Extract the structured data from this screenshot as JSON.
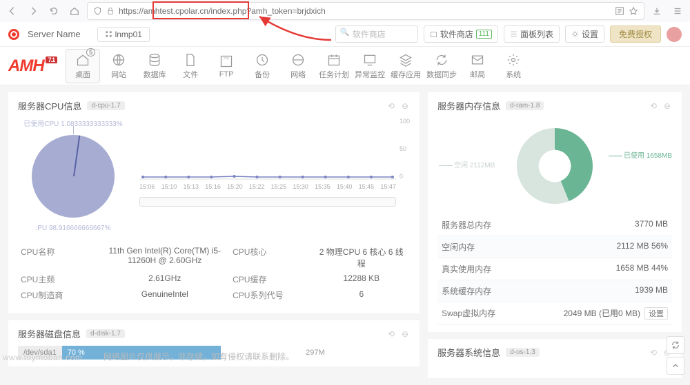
{
  "browser": {
    "url_full": "https://amhtest.cpolar.cn/index.php?amh_token=brjdxich",
    "url_highlighted": "https://amhtest.cpolar.cn"
  },
  "header": {
    "server_name": "Server Name",
    "env_tag": "lnmp01",
    "search_placeholder": "软件商店",
    "store_label": "软件商店",
    "store_badge": "111",
    "panel_list": "面板列表",
    "settings": "设置",
    "auth": "免费授权"
  },
  "logo": {
    "text": "AMH",
    "ver": "7.1"
  },
  "nav": [
    {
      "label": "桌面",
      "badge": "5",
      "active": true
    },
    {
      "label": "网站"
    },
    {
      "label": "数据库"
    },
    {
      "label": "文件"
    },
    {
      "label": "FTP"
    },
    {
      "label": "备份"
    },
    {
      "label": "网络"
    },
    {
      "label": "任务计划"
    },
    {
      "label": "异常监控"
    },
    {
      "label": "缓存应用"
    },
    {
      "label": "数据同步"
    },
    {
      "label": "邮局"
    },
    {
      "label": "系统"
    }
  ],
  "cpu_panel": {
    "title": "服务器CPU信息",
    "module": "d-cpu-1.7",
    "pie_used_label": "已使用CPU 1.0833333333333%",
    "pie_free_label": ":PU 98.916666666667%"
  },
  "chart_data": {
    "type": "line",
    "title": "",
    "xlabel": "",
    "ylabel": "",
    "ylim": [
      0,
      100
    ],
    "x": [
      "15:06",
      "15:10",
      "15:13",
      "15:16",
      "15:20",
      "15:22",
      "15:25",
      "15:30",
      "15:35",
      "15:40",
      "15:45",
      "15:47"
    ],
    "series": [
      {
        "name": "CPU",
        "values": [
          2,
          2,
          2,
          2,
          3,
          2,
          2,
          2,
          2,
          2,
          2,
          2
        ]
      }
    ],
    "yticks": [
      0,
      50,
      100
    ]
  },
  "cpu_info": {
    "name_label": "CPU名称",
    "name_val": "11th Gen Intel(R) Core(TM) i5-11260H @ 2.60GHz",
    "core_label": "CPU核心",
    "core_val": "2 物理CPU  6 核心  6 线程",
    "freq_label": "CPU主频",
    "freq_val": "2.61GHz",
    "cache_label": "CPU缓存",
    "cache_val": "12288 KB",
    "vendor_label": "CPU制造商",
    "vendor_val": "GenuineIntel",
    "family_label": "CPU系列代号",
    "family_val": "6"
  },
  "disk_panel": {
    "title": "服务器磁盘信息",
    "module": "d-disk-1.7",
    "dev": "/dev/sda1",
    "used_pct": "70 %",
    "total": "297M"
  },
  "ram_panel": {
    "title": "服务器内存信息",
    "module": "d-ram-1.8",
    "used_label": "已使用 1658MB",
    "free_label": "空闲 2112MB"
  },
  "mem_table": [
    {
      "k": "服务器总内存",
      "v": "3770 MB"
    },
    {
      "k": "空闲内存",
      "v": "2112 MB   56%"
    },
    {
      "k": "真实使用内存",
      "v": "1658 MB   44%"
    },
    {
      "k": "系统缓存内存",
      "v": "1939 MB"
    },
    {
      "k": "Swap虚拟内存",
      "v": "2049 MB (已用0 MB)",
      "btn": "设置"
    }
  ],
  "sys_panel": {
    "title": "服务器系统信息",
    "module": "d-os-1.3"
  },
  "watermark": "www.toymoban.com",
  "disclaimer": "网络图片仅供展示，非存储，如有侵权请联系删除。"
}
